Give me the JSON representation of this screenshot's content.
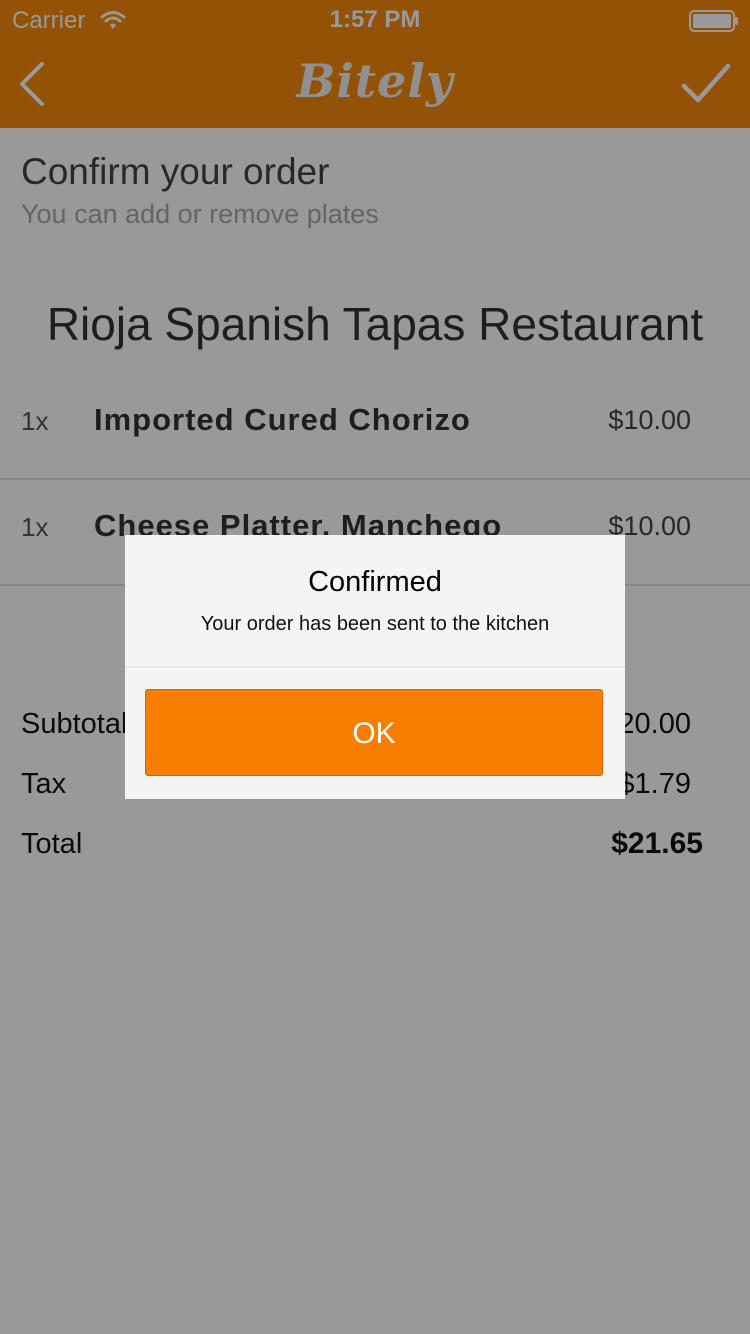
{
  "status_bar": {
    "carrier": "Carrier",
    "time": "1:57 PM",
    "wifi_icon": "wifi-icon",
    "battery_icon": "battery-full-icon"
  },
  "nav_bar": {
    "logo_text": "Bitely",
    "back_icon": "chevron-left-icon",
    "confirm_icon": "checkmark-icon",
    "background_color": "#f7890b"
  },
  "page": {
    "title": "Confirm your order",
    "subtitle": "You can add or remove plates",
    "restaurant_name": "Rioja Spanish Tapas Restaurant"
  },
  "order_items": [
    {
      "qty": "1x",
      "name": "Imported Cured Chorizo",
      "price": "$10.00"
    },
    {
      "qty": "1x",
      "name": "Cheese Platter, Manchego",
      "price": "$10.00"
    }
  ],
  "summary": {
    "subtotal_label": "Subtotal",
    "subtotal_value": "$20.00",
    "tax_label": "Tax",
    "tax_value": "$1.79",
    "total_label": "Total",
    "total_value": "$21.65"
  },
  "dialog": {
    "title": "Confirmed",
    "message": "Your order has been sent to the kitchen",
    "ok_label": "OK",
    "button_color": "#f97e00"
  }
}
